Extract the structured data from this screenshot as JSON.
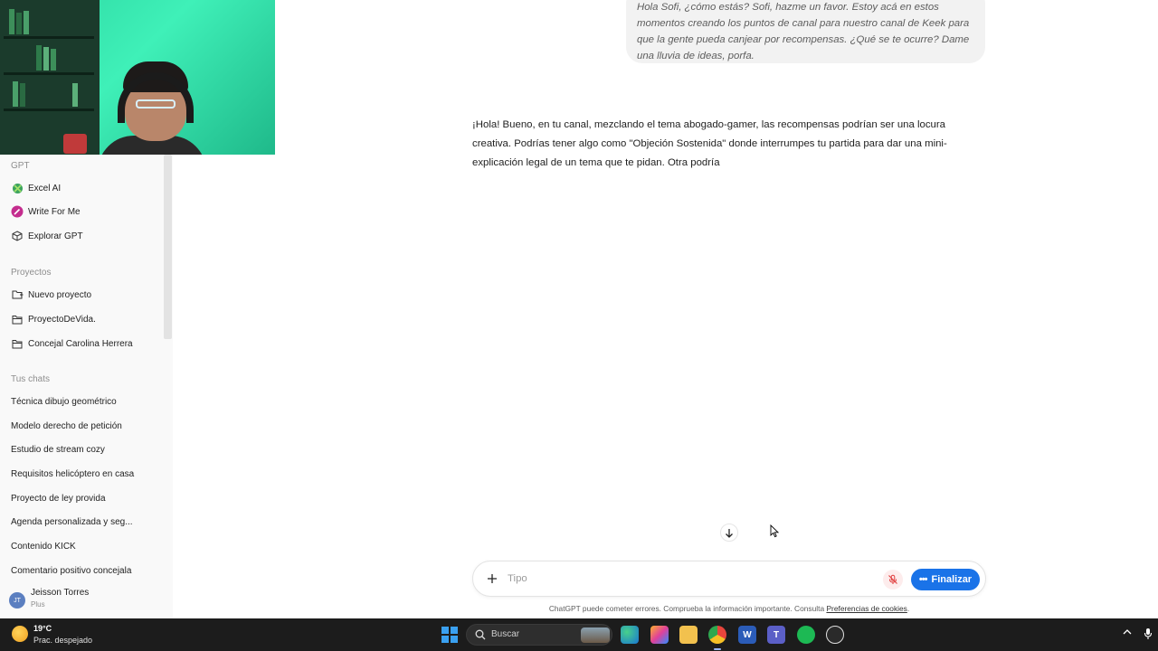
{
  "conversation": {
    "user_message": "Hola Sofi, ¿cómo estás? Sofi, hazme un favor. Estoy acá en estos momentos creando los puntos de canal para nuestro canal de Keek para que la gente pueda canjear por recompensas. ¿Qué se te ocurre? Dame una lluvia de ideas, porfa.",
    "assistant_message": "¡Hola! Bueno, en tu canal, mezclando el tema abogado-gamer, las recompensas podrían ser una locura creativa. Podrías tener algo como \"Objeción Sostenida\" donde interrumpes tu partida para dar una mini-explicación legal de un tema que te pidan. Otra podría"
  },
  "sidebar": {
    "gpt_label": "GPT",
    "gpts": [
      {
        "label": "Excel AI",
        "icon": "excel-ai-icon"
      },
      {
        "label": "Write For Me",
        "icon": "write-for-me-icon"
      },
      {
        "label": "Explorar GPT",
        "icon": "cube-icon"
      }
    ],
    "projects_label": "Proyectos",
    "projects": [
      {
        "label": "Nuevo proyecto",
        "icon": "new-folder-icon"
      },
      {
        "label": "ProyectoDeVida.",
        "icon": "folder-icon"
      },
      {
        "label": "Concejal Carolina Herrera",
        "icon": "folder-icon"
      }
    ],
    "chats_label": "Tus chats",
    "chats": [
      "Técnica dibujo geométrico",
      "Modelo derecho de petición",
      "Estudio de stream cozy",
      "Requisitos helicóptero en casa",
      "Proyecto de ley provida",
      "Agenda personalizada y seg...",
      "Contenido KICK",
      "Comentario positivo concejala"
    ],
    "user": {
      "initials": "JT",
      "name": "Jeisson Torres",
      "plan": "Plus"
    }
  },
  "composer": {
    "placeholder": "Tipo",
    "value": "",
    "finish_label": "Finalizar"
  },
  "disclaimer": {
    "text": "ChatGPT puede cometer errores. Comprueba la información importante. Consulta ",
    "link": "Preferencias de cookies",
    "end": "."
  },
  "taskbar": {
    "temperature": "19°C",
    "weather": "Prac. despejado",
    "search_label": "Buscar",
    "apps": [
      "edge-icon",
      "copilot-icon",
      "file-explorer-icon",
      "chrome-icon",
      "word-icon",
      "teams-icon",
      "spotify-icon",
      "chatgpt-icon"
    ]
  },
  "colors": {
    "accent": "#1a73e8",
    "sidebar_bg": "#f9f9f9",
    "bubble_bg": "#f2f2f2",
    "taskbar_bg": "#1c1c1c"
  }
}
